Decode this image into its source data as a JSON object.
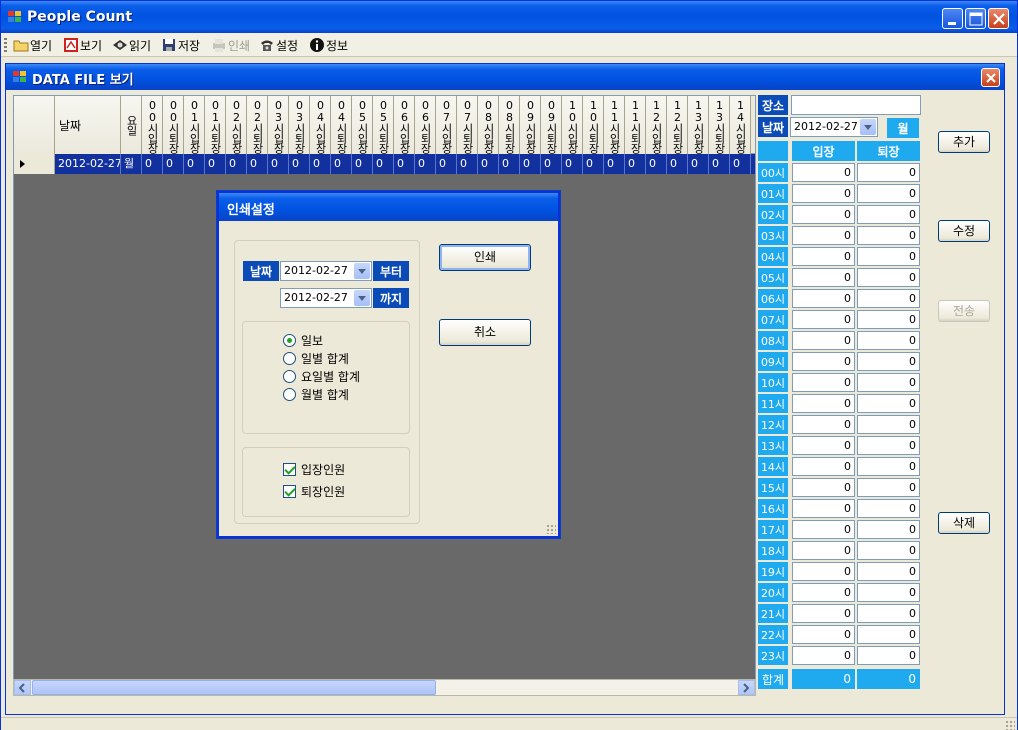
{
  "app": {
    "title": "People Count"
  },
  "toolbar": [
    {
      "id": "open",
      "label": "열기",
      "icon": "folder-icon",
      "disabled": false
    },
    {
      "id": "view",
      "label": "보기",
      "icon": "view-icon",
      "disabled": false
    },
    {
      "id": "read",
      "label": "읽기",
      "icon": "read-icon",
      "disabled": false
    },
    {
      "id": "save",
      "label": "저장",
      "icon": "save-icon",
      "disabled": false
    },
    {
      "id": "print",
      "label": "인쇄",
      "icon": "printer-icon",
      "disabled": true
    },
    {
      "id": "settings",
      "label": "설정",
      "icon": "phone-icon",
      "disabled": false
    },
    {
      "id": "info",
      "label": "정보",
      "icon": "info-icon",
      "disabled": false
    }
  ],
  "child": {
    "title": "DATA FILE 보기"
  },
  "grid": {
    "date_header": "날짜",
    "weekday_header": "요일",
    "hour_headers": [
      "00시입장",
      "00시퇴장",
      "01시입장",
      "01시퇴장",
      "02시입장",
      "02시퇴장",
      "03시입장",
      "03시퇴장",
      "04시입장",
      "04시퇴장",
      "05시입장",
      "05시퇴장",
      "06시입장",
      "06시퇴장",
      "07시입장",
      "07시퇴장",
      "08시입장",
      "08시퇴장",
      "09시입장",
      "09시퇴장",
      "10시입장",
      "10시퇴장",
      "11시입장",
      "11시퇴장",
      "12시입장",
      "12시퇴장",
      "13시입장",
      "13시퇴장",
      "14시입장"
    ],
    "row": {
      "date": "2012-02-27",
      "weekday": "월",
      "values": [
        "0",
        "0",
        "0",
        "0",
        "0",
        "0",
        "0",
        "0",
        "0",
        "0",
        "0",
        "0",
        "0",
        "0",
        "0",
        "0",
        "0",
        "0",
        "0",
        "0",
        "0",
        "0",
        "0",
        "0",
        "0",
        "0",
        "0",
        "0",
        "0"
      ]
    }
  },
  "panel": {
    "place_label": "장소",
    "place_value": "",
    "date_label": "날짜",
    "date_value": "2012-02-27",
    "month_button": "월",
    "enter_header": "입장",
    "exit_header": "퇴장",
    "hours": [
      {
        "h": "00시",
        "in": "0",
        "out": "0"
      },
      {
        "h": "01시",
        "in": "0",
        "out": "0"
      },
      {
        "h": "02시",
        "in": "0",
        "out": "0"
      },
      {
        "h": "03시",
        "in": "0",
        "out": "0"
      },
      {
        "h": "04시",
        "in": "0",
        "out": "0"
      },
      {
        "h": "05시",
        "in": "0",
        "out": "0"
      },
      {
        "h": "06시",
        "in": "0",
        "out": "0"
      },
      {
        "h": "07시",
        "in": "0",
        "out": "0"
      },
      {
        "h": "08시",
        "in": "0",
        "out": "0"
      },
      {
        "h": "09시",
        "in": "0",
        "out": "0"
      },
      {
        "h": "10시",
        "in": "0",
        "out": "0"
      },
      {
        "h": "11시",
        "in": "0",
        "out": "0"
      },
      {
        "h": "12시",
        "in": "0",
        "out": "0"
      },
      {
        "h": "13시",
        "in": "0",
        "out": "0"
      },
      {
        "h": "14시",
        "in": "0",
        "out": "0"
      },
      {
        "h": "15시",
        "in": "0",
        "out": "0"
      },
      {
        "h": "16시",
        "in": "0",
        "out": "0"
      },
      {
        "h": "17시",
        "in": "0",
        "out": "0"
      },
      {
        "h": "18시",
        "in": "0",
        "out": "0"
      },
      {
        "h": "19시",
        "in": "0",
        "out": "0"
      },
      {
        "h": "20시",
        "in": "0",
        "out": "0"
      },
      {
        "h": "21시",
        "in": "0",
        "out": "0"
      },
      {
        "h": "22시",
        "in": "0",
        "out": "0"
      },
      {
        "h": "23시",
        "in": "0",
        "out": "0"
      }
    ],
    "total_label": "합계",
    "total_in": "0",
    "total_out": "0"
  },
  "side_buttons": {
    "add": "추가",
    "edit": "수정",
    "send": "전송",
    "delete": "삭제"
  },
  "dialog": {
    "title": "인쇄설정",
    "date_label": "날짜",
    "from_date": "2012-02-27",
    "from_suffix": "부터",
    "to_date": "2012-02-27",
    "to_suffix": "까지",
    "report_options": [
      {
        "label": "일보",
        "selected": true
      },
      {
        "label": "일별 합계",
        "selected": false
      },
      {
        "label": "요일별 합계",
        "selected": false
      },
      {
        "label": "월별 합계",
        "selected": false
      }
    ],
    "checks": [
      {
        "label": "입장인원",
        "checked": true
      },
      {
        "label": "퇴장인원",
        "checked": true
      }
    ],
    "print_button": "인쇄",
    "cancel_button": "취소"
  },
  "colors": {
    "title_blue": "#0052e0",
    "label_dark": "#0a4bb8",
    "label_light": "#1faaf0",
    "row_selected": "#12319e",
    "mdi_bg": "#696969"
  }
}
